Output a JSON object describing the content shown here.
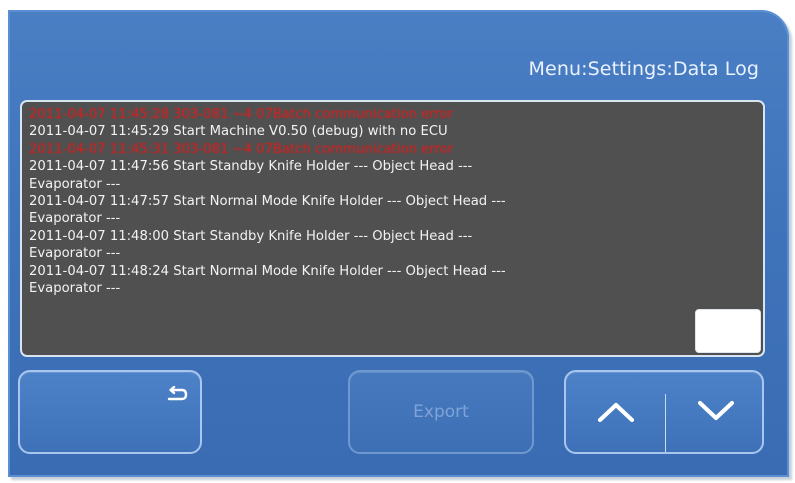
{
  "header": {
    "breadcrumb": "Menu:Settings:Data Log"
  },
  "log": {
    "lines": [
      {
        "text": "2011-04-07 11:45:28  303-081 ~4 07Batch communication error",
        "type": "error"
      },
      {
        "text": "2011-04-07 11:45:29  Start Machine V0.50 (debug) with no ECU",
        "type": "info"
      },
      {
        "text": "2011-04-07 11:45:31  303-081 ~4 07Batch communication error",
        "type": "error"
      },
      {
        "text": "2011-04-07 11:47:56  Start Standby  Knife Holder --- Object Head ---",
        "type": "info"
      },
      {
        "text": "Evaporator ---",
        "type": "info"
      },
      {
        "text": "2011-04-07 11:47:57  Start Normal Mode  Knife Holder --- Object Head ---",
        "type": "info"
      },
      {
        "text": "Evaporator ---",
        "type": "info"
      },
      {
        "text": "2011-04-07 11:48:00  Start Standby  Knife Holder --- Object Head ---",
        "type": "info"
      },
      {
        "text": "Evaporator ---",
        "type": "info"
      },
      {
        "text": "2011-04-07 11:48:24  Start Normal Mode  Knife Holder --- Object Head ---",
        "type": "info"
      },
      {
        "text": "Evaporator ---",
        "type": "info"
      }
    ],
    "scroll_position": 1.0
  },
  "buttons": {
    "back_icon": "return-arrow-icon",
    "export_label": "Export",
    "export_enabled": false,
    "scroll_up_icon": "chevron-up-icon",
    "scroll_down_icon": "chevron-down-icon"
  },
  "colors": {
    "panel_blue": "#3f73ba",
    "log_background": "#505050",
    "error_text": "#e11b1b",
    "normal_text": "#f2f2f2"
  }
}
